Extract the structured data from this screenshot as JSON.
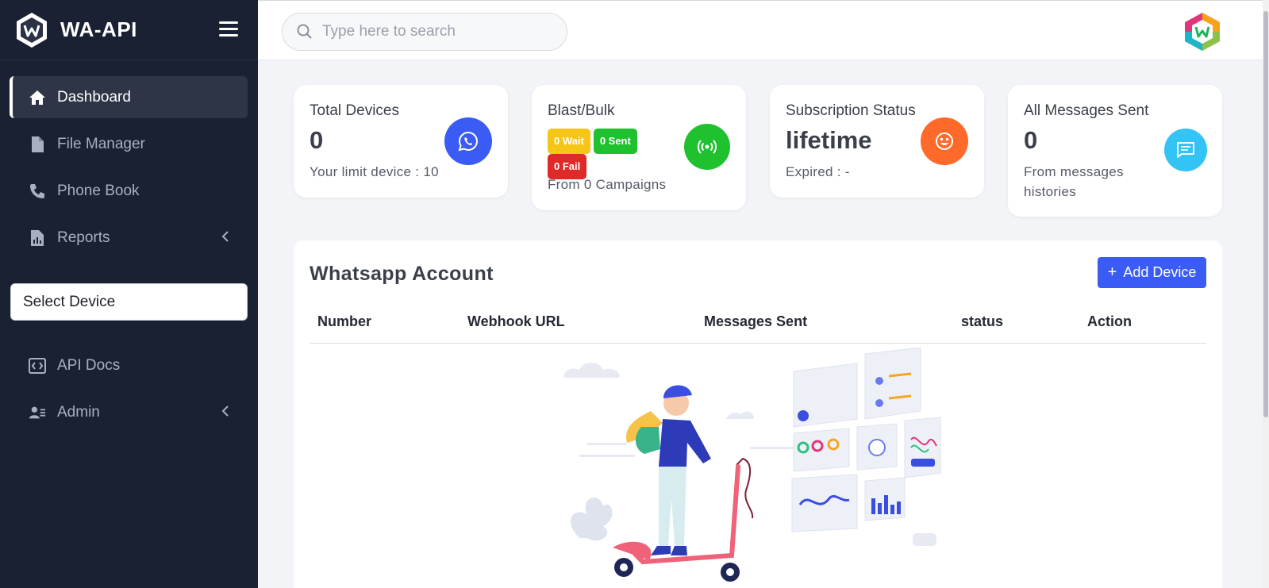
{
  "brand": {
    "name": "WA-API"
  },
  "sidebar": {
    "items": [
      {
        "label": "Dashboard",
        "icon": "home-icon",
        "active": true
      },
      {
        "label": "File Manager",
        "icon": "file-icon"
      },
      {
        "label": "Phone Book",
        "icon": "phone-icon"
      },
      {
        "label": "Reports",
        "icon": "chart-icon",
        "has_children": true
      }
    ],
    "select_device": "Select Device",
    "items2": [
      {
        "label": "API Docs",
        "icon": "code-icon"
      },
      {
        "label": "Admin",
        "icon": "user-list-icon",
        "has_children": true
      }
    ]
  },
  "header": {
    "search_placeholder": "Type here to search"
  },
  "cards": {
    "total_devices": {
      "title": "Total Devices",
      "value": "0",
      "sub": "Your limit device : 10",
      "icon": "whatsapp-icon",
      "color": "#3b5bf5"
    },
    "blast": {
      "title": "Blast/Bulk",
      "wait": "0 Wait",
      "sent": "0 Sent",
      "fail": "0 Fail",
      "sub": "From 0 Campaigns",
      "icon": "broadcast-icon",
      "color": "#1fc12f"
    },
    "subscription": {
      "title": "Subscription Status",
      "value": "lifetime",
      "sub": "Expired : -",
      "icon": "smile-icon",
      "color": "#ff6a2b"
    },
    "messages": {
      "title": "All Messages Sent",
      "value": "0",
      "sub_line1": "From messages",
      "sub_line2": "histories",
      "icon": "chat-icon",
      "color": "#33c3f5"
    }
  },
  "panel": {
    "title": "Whatsapp Account",
    "add_button": "Add Device",
    "columns": [
      "Number",
      "Webhook URL",
      "Messages Sent",
      "status",
      "Action"
    ]
  },
  "colors": {
    "sidebar_bg": "#1a2133",
    "accent": "#3b5bf5",
    "wait": "#f5c518",
    "sent": "#1fc12f",
    "fail": "#e02a2a"
  }
}
